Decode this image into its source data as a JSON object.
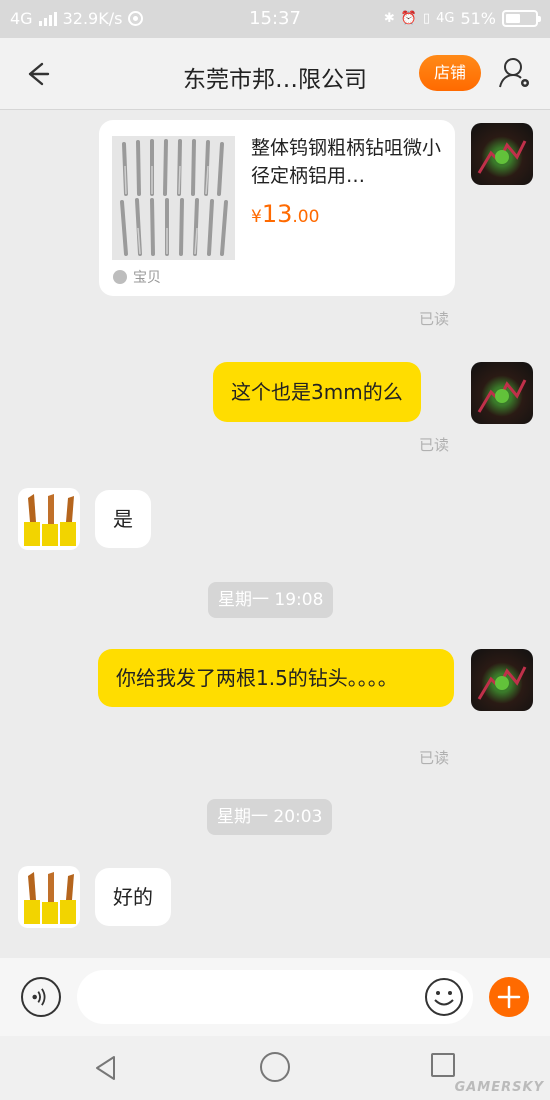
{
  "status_bar": {
    "network": "4G",
    "speed": "32.9K/s",
    "time": "15:37",
    "volte": "4G",
    "battery_text": "51%",
    "battery_level": 0.51
  },
  "header": {
    "title": "东莞市邦…限公司",
    "store_label": "店铺"
  },
  "product_card": {
    "title": "整体钨钢粗柄钻咀微小径定柄铝用…",
    "price_symbol": "¥",
    "price_main": "13",
    "price_decimal": ".00",
    "tag": "宝贝",
    "read_status": "已读"
  },
  "messages": [
    {
      "side": "me",
      "text": "这个也是3mm的么",
      "read_status": "已读"
    },
    {
      "side": "seller",
      "text": "是"
    },
    {
      "timestamp": "星期一 19:08"
    },
    {
      "side": "me",
      "text": "你给我发了两根1.5的钻头。。。。",
      "read_status": "已读"
    },
    {
      "timestamp": "星期一 20:03"
    },
    {
      "side": "seller",
      "text": "好的"
    }
  ],
  "input": {
    "placeholder": "",
    "value": ""
  },
  "watermark": "GAMERSKY",
  "colors": {
    "accent_orange": "#ff6a00",
    "my_bubble": "#ffdd00",
    "price": "#ff6a00"
  }
}
